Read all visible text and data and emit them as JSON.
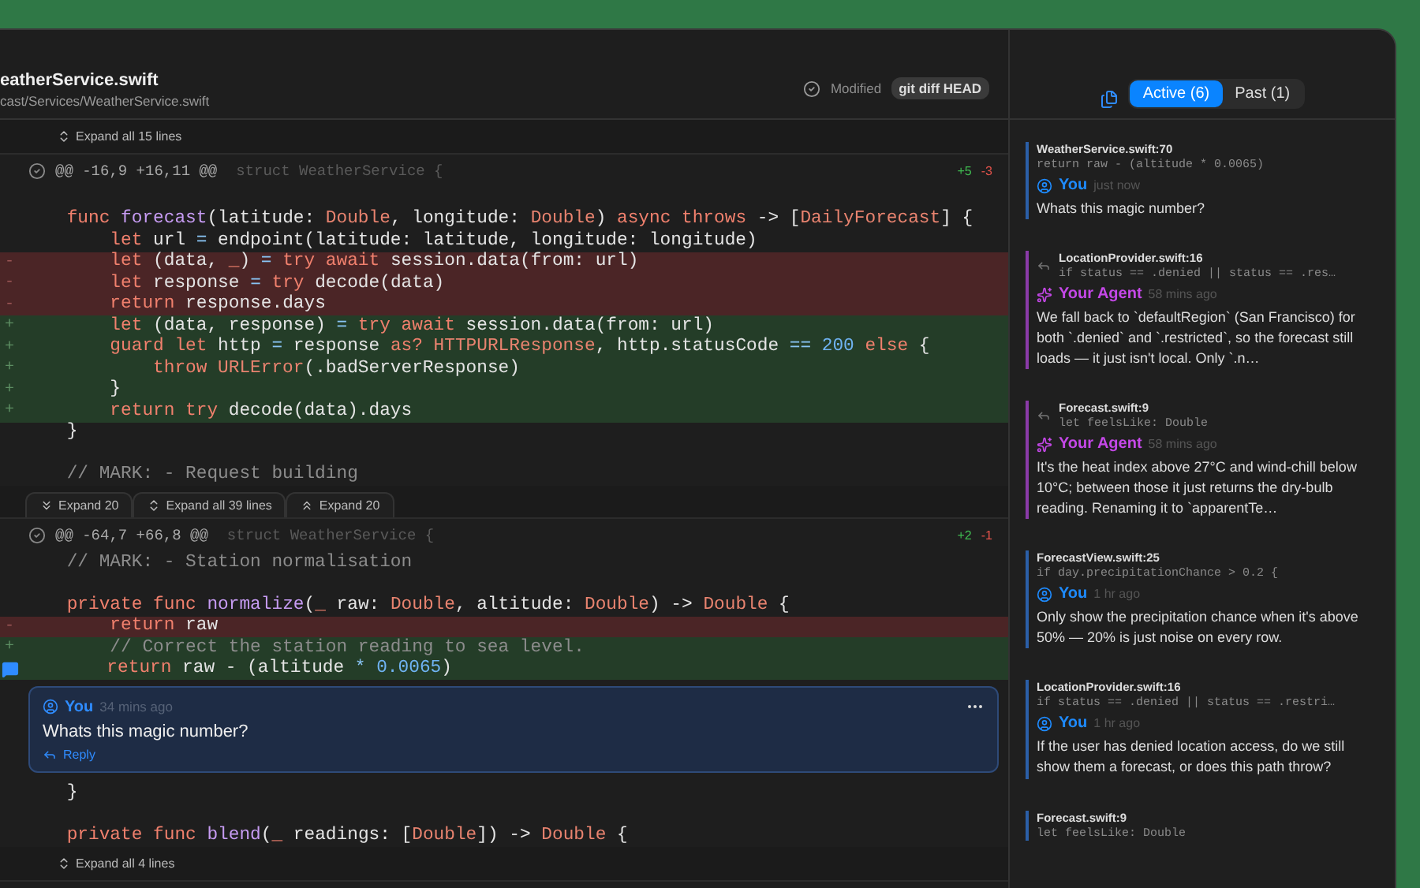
{
  "file": {
    "title": "eatherService.swift",
    "path": "cast/Services/WeatherService.swift",
    "status": "Modified",
    "badge": "git diff HEAD"
  },
  "diff": [
    {
      "kind": "expand",
      "buttons": [
        {
          "kind": "all",
          "label": "Expand all 15 lines"
        }
      ]
    },
    {
      "kind": "hunk",
      "range": "@@ -16,9 +16,11 @@",
      "context": "struct WeatherService {",
      "added": "+5",
      "removed": "-3",
      "lines": [
        {
          "kind": "context"
        },
        {
          "kind": "context",
          "tokens": [
            {
              "kind": "kw",
              "s": "    func "
            },
            {
              "kind": "fn",
              "s": "forecast"
            },
            {
              "kind": "p",
              "s": "(latitude: "
            },
            {
              "kind": "ty",
              "s": "Double"
            },
            {
              "kind": "p",
              "s": ", longitude: "
            },
            {
              "kind": "ty",
              "s": "Double"
            },
            {
              "kind": "p",
              "s": ") "
            },
            {
              "kind": "kw",
              "s": "async throws "
            },
            {
              "kind": "p",
              "s": "-> ["
            },
            {
              "kind": "ty",
              "s": "DailyForecast"
            },
            {
              "kind": "p",
              "s": "] {"
            }
          ]
        },
        {
          "kind": "context",
          "tokens": [
            {
              "kind": "kw",
              "s": "        let "
            },
            {
              "kind": "p",
              "s": "url "
            },
            {
              "kind": "op",
              "s": "="
            },
            {
              "kind": "p",
              "s": " endpoint(latitude: latitude, longitude: longitude)"
            }
          ]
        },
        {
          "kind": "removed",
          "gutter": "-",
          "tokens": [
            {
              "kind": "kw",
              "s": "        let "
            },
            {
              "kind": "p",
              "s": "(data, "
            },
            {
              "kind": "kw",
              "s": "_"
            },
            {
              "kind": "p",
              "s": ") "
            },
            {
              "kind": "op",
              "s": "="
            },
            {
              "kind": "kw",
              "s": " try await "
            },
            {
              "kind": "p",
              "s": "session.data(from: url)"
            }
          ]
        },
        {
          "kind": "removed",
          "gutter": "-",
          "tokens": [
            {
              "kind": "kw",
              "s": "        let "
            },
            {
              "kind": "p",
              "s": "response "
            },
            {
              "kind": "op",
              "s": "="
            },
            {
              "kind": "kw",
              "s": " try "
            },
            {
              "kind": "p",
              "s": "decode(data)"
            }
          ]
        },
        {
          "kind": "removed",
          "gutter": "-",
          "tokens": [
            {
              "kind": "kw",
              "s": "        return "
            },
            {
              "kind": "p",
              "s": "response.days"
            }
          ]
        },
        {
          "kind": "added",
          "gutter": "+",
          "tokens": [
            {
              "kind": "kw",
              "s": "        let "
            },
            {
              "kind": "p",
              "s": "(data, response) "
            },
            {
              "kind": "op",
              "s": "="
            },
            {
              "kind": "kw",
              "s": " try await "
            },
            {
              "kind": "p",
              "s": "session.data(from: url)"
            }
          ]
        },
        {
          "kind": "added",
          "gutter": "+",
          "tokens": [
            {
              "kind": "kw",
              "s": "        guard let "
            },
            {
              "kind": "p",
              "s": "http "
            },
            {
              "kind": "op",
              "s": "="
            },
            {
              "kind": "p",
              "s": " response "
            },
            {
              "kind": "kw",
              "s": "as? "
            },
            {
              "kind": "ty",
              "s": "HTTPURLResponse"
            },
            {
              "kind": "p",
              "s": ", http.statusCode "
            },
            {
              "kind": "op",
              "s": "=="
            },
            {
              "kind": "num",
              "s": " 200"
            },
            {
              "kind": "kw",
              "s": " else"
            },
            {
              "kind": "p",
              "s": " {"
            }
          ]
        },
        {
          "kind": "added",
          "gutter": "+",
          "tokens": [
            {
              "kind": "kw",
              "s": "            throw "
            },
            {
              "kind": "ty",
              "s": "URLError"
            },
            {
              "kind": "p",
              "s": "(.badServerResponse)"
            }
          ]
        },
        {
          "kind": "added",
          "gutter": "+",
          "tokens": [
            {
              "kind": "p",
              "s": "        }"
            }
          ]
        },
        {
          "kind": "added",
          "gutter": "+",
          "tokens": [
            {
              "kind": "kw",
              "s": "        return try "
            },
            {
              "kind": "p",
              "s": "decode(data).days"
            }
          ]
        },
        {
          "kind": "context",
          "tokens": [
            {
              "kind": "p",
              "s": "    }"
            }
          ]
        },
        {
          "kind": "context"
        },
        {
          "kind": "context",
          "tokens": [
            {
              "kind": "cm",
              "s": "    // MARK: - Request building"
            }
          ]
        }
      ]
    },
    {
      "kind": "expand",
      "buttons": [
        {
          "kind": "down",
          "label": "Expand 20"
        },
        {
          "kind": "all",
          "label": "Expand all 39 lines"
        },
        {
          "kind": "up",
          "label": "Expand 20"
        }
      ]
    },
    {
      "kind": "hunk",
      "range": "@@ -64,7 +66,8 @@",
      "context": "struct WeatherService {",
      "added": "+2",
      "removed": "-1",
      "lines": [
        {
          "kind": "context",
          "tokens": [
            {
              "kind": "cm",
              "s": "    // MARK: - Station normalisation"
            }
          ]
        },
        {
          "kind": "context"
        },
        {
          "kind": "context",
          "tokens": [
            {
              "kind": "kw",
              "s": "    private func "
            },
            {
              "kind": "fn",
              "s": "normalize"
            },
            {
              "kind": "p",
              "s": "("
            },
            {
              "kind": "kw",
              "s": "_"
            },
            {
              "kind": "p",
              "s": " raw: "
            },
            {
              "kind": "ty",
              "s": "Double"
            },
            {
              "kind": "p",
              "s": ", altitude: "
            },
            {
              "kind": "ty",
              "s": "Double"
            },
            {
              "kind": "p",
              "s": ") -> "
            },
            {
              "kind": "ty",
              "s": "Double"
            },
            {
              "kind": "p",
              "s": " {"
            }
          ]
        },
        {
          "kind": "removed",
          "gutter": "-",
          "tokens": [
            {
              "kind": "kw",
              "s": "        return "
            },
            {
              "kind": "p",
              "s": "raw"
            }
          ]
        },
        {
          "kind": "added",
          "gutter": "+",
          "tokens": [
            {
              "kind": "cm",
              "s": "        // Correct the station reading to sea level."
            }
          ]
        },
        {
          "kind": "added",
          "tokens": [
            {
              "kind": "kw",
              "s": "        return "
            },
            {
              "kind": "p",
              "s": "raw - (altitude "
            },
            {
              "kind": "op",
              "s": "*"
            },
            {
              "kind": "num",
              "s": " 0.0065"
            },
            {
              "kind": "p",
              "s": ")"
            }
          ],
          "comment": {
            "author": "You",
            "time": "34 mins ago",
            "text": "Whats this magic number?",
            "action": "Reply"
          }
        },
        {
          "kind": "context",
          "tokens": [
            {
              "kind": "p",
              "s": "    }"
            }
          ]
        },
        {
          "kind": "context"
        },
        {
          "kind": "context",
          "tokens": [
            {
              "kind": "kw",
              "s": "    private func "
            },
            {
              "kind": "fn",
              "s": "blend"
            },
            {
              "kind": "p",
              "s": "("
            },
            {
              "kind": "kw",
              "s": "_"
            },
            {
              "kind": "p",
              "s": " readings: ["
            },
            {
              "kind": "ty",
              "s": "Double"
            },
            {
              "kind": "p",
              "s": "]) -> "
            },
            {
              "kind": "ty",
              "s": "Double"
            },
            {
              "kind": "p",
              "s": " {"
            }
          ]
        }
      ]
    },
    {
      "kind": "expand",
      "buttons": [
        {
          "kind": "all",
          "label": "Expand all 4 lines"
        }
      ]
    }
  ],
  "sidebar": {
    "tabs": [
      {
        "label": "Active (6)",
        "selected": true
      },
      {
        "label": "Past (1)",
        "selected": false
      }
    ],
    "comments": [
      {
        "kind": "user",
        "file": "WeatherService.swift:70",
        "code": "return raw - (altitude * 0.0065)",
        "author": "You",
        "time": "just now",
        "text": "Whats this magic number?"
      },
      {
        "kind": "agent",
        "file": "LocationProvider.swift:16",
        "code": "if status == .denied || status == .res…",
        "author": "Your Agent",
        "time": "58 mins ago",
        "text": "We fall back to `defaultRegion` (San Francisco) for both `.denied` and `.restricted`, so the forecast still loads — it just isn't local. Only `.n…"
      },
      {
        "kind": "agent",
        "file": "Forecast.swift:9",
        "code": "let feelsLike: Double",
        "author": "Your Agent",
        "time": "58 mins ago",
        "text": "It's the heat index above 27°C and wind-chill below 10°C; between those it just returns the dry-bulb reading. Renaming it to `apparentTe…"
      },
      {
        "kind": "user",
        "file": "ForecastView.swift:25",
        "code": "if day.precipitationChance > 0.2 {",
        "author": "You",
        "time": "1 hr ago",
        "text": "Only show the precipitation chance when it's above 50% — 20% is just noise on every row."
      },
      {
        "kind": "user",
        "file": "LocationProvider.swift:16",
        "code": "if status == .denied || status == .restri…",
        "author": "You",
        "time": "1 hr ago",
        "text": "If the user has denied location access, do we still show them a forecast, or does this path throw?"
      },
      {
        "kind": "user",
        "file": "Forecast.swift:9",
        "code": "let feelsLike: Double"
      }
    ]
  }
}
